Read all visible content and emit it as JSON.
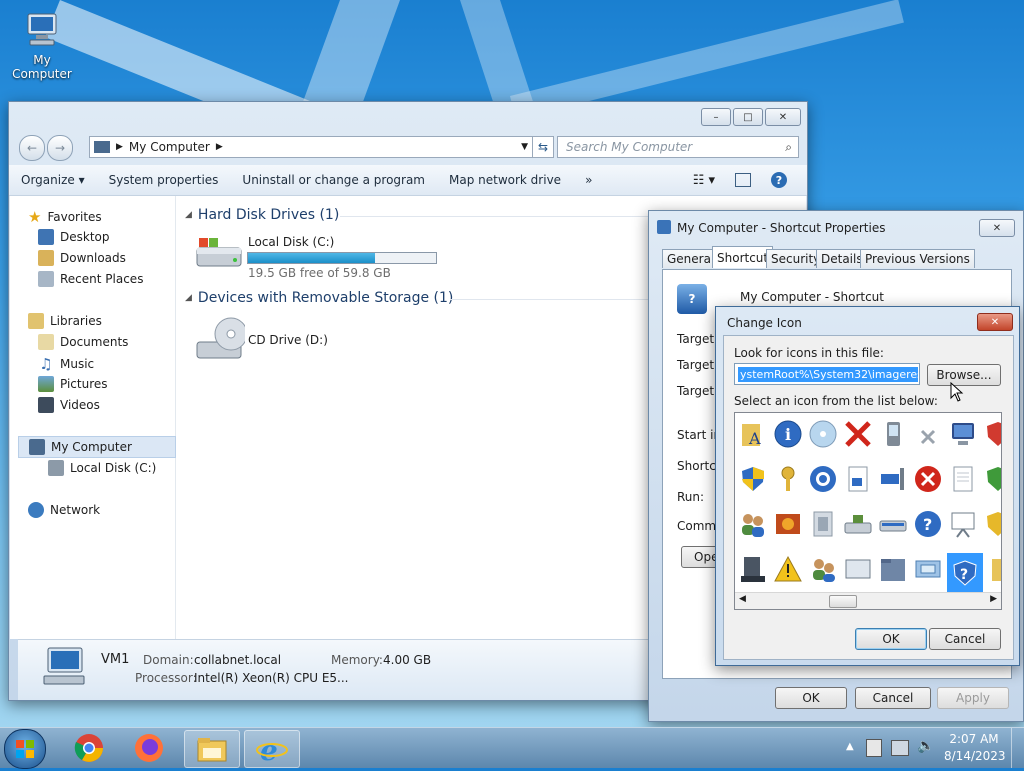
{
  "desktop": {
    "icon_label": "My Computer"
  },
  "explorer": {
    "address_path": "My Computer",
    "search_placeholder": "Search My Computer",
    "toolbar": [
      "Organize",
      "System properties",
      "Uninstall or change a program",
      "Map network drive",
      "»"
    ],
    "nav": {
      "favorites": "Favorites",
      "favorites_items": [
        "Desktop",
        "Downloads",
        "Recent Places"
      ],
      "libraries": "Libraries",
      "libraries_items": [
        "Documents",
        "Music",
        "Pictures",
        "Videos"
      ],
      "computer": "My Computer",
      "computer_items": [
        "Local Disk (C:)"
      ],
      "network": "Network"
    },
    "groups": {
      "hdd": "Hard Disk Drives (1)",
      "removable": "Devices with Removable Storage (1)"
    },
    "drives": {
      "c_name": "Local Disk (C:)",
      "c_free": "19.5 GB free of 59.8 GB",
      "c_used_fraction": 0.674,
      "d_name": "CD Drive (D:)"
    },
    "status": {
      "computer_name": "VM1",
      "domain_label": "Domain:",
      "domain_value": "collabnet.local",
      "memory_label": "Memory:",
      "memory_value": "4.00 GB",
      "processor_label": "Processor:",
      "processor_value": "Intel(R) Xeon(R) CPU E5..."
    }
  },
  "properties": {
    "title": "My Computer - Shortcut Properties",
    "tabs": [
      "General",
      "Shortcut",
      "Security",
      "Details",
      "Previous Versions"
    ],
    "name": "My Computer - Shortcut",
    "labels": [
      "Target ty",
      "Target lo",
      "Target:",
      "Start in:",
      "Shortcut",
      "Run:",
      "Commen"
    ],
    "open_button": "Ope",
    "ok": "OK",
    "cancel": "Cancel",
    "apply": "Apply"
  },
  "change_icon": {
    "title": "Change Icon",
    "look_label": "Look for icons in this file:",
    "file_value": "ystemRoot%\\System32\\imageres.dll",
    "browse": "Browse...",
    "select_label": "Select an icon from the list below:",
    "ok": "OK",
    "cancel": "Cancel"
  },
  "taskbar": {
    "time": "2:07 AM",
    "date": "8/14/2023"
  }
}
